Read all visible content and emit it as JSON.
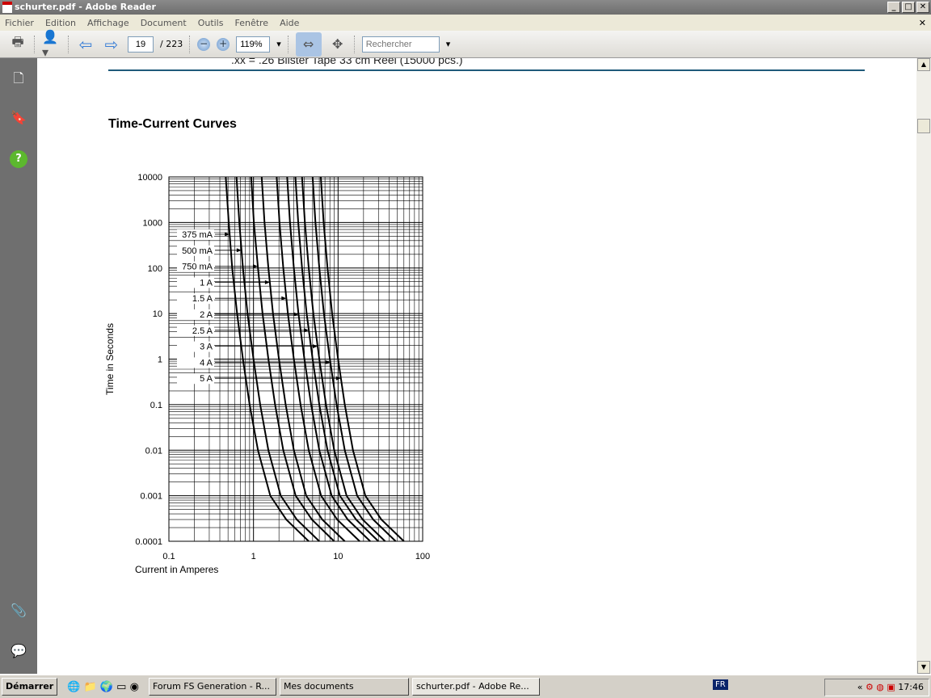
{
  "window": {
    "title": "schurter.pdf - Adobe Reader"
  },
  "menu": [
    "Fichier",
    "Edition",
    "Affichage",
    "Document",
    "Outils",
    "Fenêtre",
    "Aide"
  ],
  "toolbar": {
    "page": "19",
    "page_total": "/ 223",
    "zoom": "119%",
    "search_placeholder": "Rechercher"
  },
  "document": {
    "cut_text": ".xx = .26 Blister Tape 33 cm Reel (15000 pcs.)",
    "section_title": "Time-Current Curves"
  },
  "chart_data": {
    "type": "line",
    "xlabel": "Current in Amperes",
    "ylabel": "Time in Seconds",
    "xscale": "log",
    "yscale": "log",
    "xlim": [
      0.1,
      100
    ],
    "ylim": [
      0.0001,
      10000
    ],
    "xticks": [
      "0.1",
      "1",
      "10",
      "100"
    ],
    "yticks": [
      "10000",
      "1000",
      "100",
      "10",
      "1",
      "0.1",
      "0.01",
      "0.001",
      "0.0001"
    ],
    "time": [
      10000,
      1000,
      100,
      10,
      1,
      0.1,
      0.01,
      0.001,
      0.0003,
      0.0001
    ],
    "series": [
      {
        "name": "375 mA",
        "current": [
          0.47,
          0.51,
          0.56,
          0.64,
          0.75,
          0.9,
          1.13,
          1.58,
          2.44,
          4.5
        ]
      },
      {
        "name": "500 mA",
        "current": [
          0.63,
          0.68,
          0.75,
          0.85,
          1.0,
          1.2,
          1.5,
          2.1,
          3.25,
          6
        ]
      },
      {
        "name": "750 mA",
        "current": [
          0.94,
          1.01,
          1.13,
          1.28,
          1.5,
          1.8,
          2.25,
          3.15,
          4.9,
          9
        ]
      },
      {
        "name": "1 A",
        "current": [
          1.25,
          1.35,
          1.5,
          1.7,
          2,
          2.4,
          3,
          4.2,
          6.5,
          12
        ]
      },
      {
        "name": "1.5 A",
        "current": [
          1.88,
          2.03,
          2.25,
          2.55,
          3,
          3.6,
          4.5,
          6.3,
          9.75,
          18
        ]
      },
      {
        "name": "2 A",
        "current": [
          2.5,
          2.7,
          3,
          3.4,
          4,
          4.8,
          6,
          8.4,
          13,
          24
        ]
      },
      {
        "name": "2.5 A",
        "current": [
          3.13,
          3.38,
          3.75,
          4.25,
          5,
          6,
          7.5,
          10.5,
          16.3,
          30
        ]
      },
      {
        "name": "3 A",
        "current": [
          3.75,
          4.05,
          4.5,
          5.1,
          6,
          7.2,
          9,
          12.6,
          19.5,
          36
        ]
      },
      {
        "name": "4 A",
        "current": [
          5,
          5.4,
          6,
          6.8,
          8,
          9.6,
          12,
          16.8,
          26,
          48
        ]
      },
      {
        "name": "5 A",
        "current": [
          6.25,
          6.75,
          7.5,
          8.5,
          10,
          12,
          15,
          21,
          32.5,
          60
        ]
      }
    ]
  },
  "taskbar": {
    "start": "Démarrer",
    "tasks": [
      "Forum FS Generation - R...",
      "Mes documents",
      "schurter.pdf - Adobe Re..."
    ],
    "lang": "FR",
    "clock": "17:46",
    "tray_expand": "«"
  }
}
